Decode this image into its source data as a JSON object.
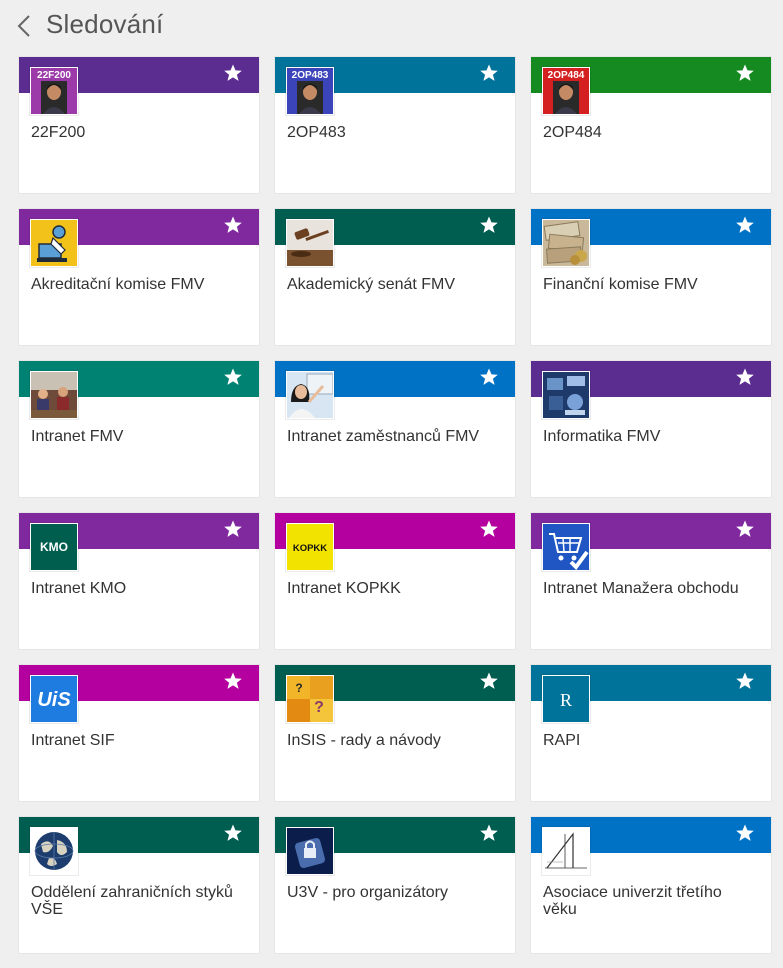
{
  "header": {
    "title": "Sledování",
    "back_icon": "chevron-left-icon"
  },
  "tiles": [
    {
      "name": "22F200",
      "color": "#5c2d91",
      "logo": "portrait-badge",
      "logo_text": "22F200",
      "logo_bg": "#9b3aa8"
    },
    {
      "name": "2OP483",
      "color": "#00739a",
      "logo": "portrait-badge",
      "logo_text": "2OP483",
      "logo_bg": "#3b44b8"
    },
    {
      "name": "2OP484",
      "color": "#148a21",
      "logo": "portrait-badge",
      "logo_text": "2OP484",
      "logo_bg": "#d42020"
    },
    {
      "name": "Akreditační komise FMV",
      "color": "#80299e",
      "logo": "person-computer",
      "logo_text": "",
      "logo_bg": "#f2c21a"
    },
    {
      "name": "Akademický senát FMV",
      "color": "#005e51",
      "logo": "gavel",
      "logo_text": "",
      "logo_bg": "#e8e3dc"
    },
    {
      "name": "Finanční komise FMV",
      "color": "#0072c6",
      "logo": "banknotes",
      "logo_text": "",
      "logo_bg": "#c9b99a"
    },
    {
      "name": "Intranet FMV",
      "color": "#008272",
      "logo": "classroom",
      "logo_text": "",
      "logo_bg": "#6e4a3a"
    },
    {
      "name": "Intranet zaměstnanců FMV",
      "color": "#0072c6",
      "logo": "presenter",
      "logo_text": "",
      "logo_bg": "#d7e6f2"
    },
    {
      "name": "Informatika FMV",
      "color": "#5c2d91",
      "logo": "tech-collage",
      "logo_text": "",
      "logo_bg": "#1d3a6b"
    },
    {
      "name": "Intranet KMO",
      "color": "#80299e",
      "logo": "text-badge",
      "logo_text": "KMO",
      "logo_bg": "#005e4e"
    },
    {
      "name": "Intranet KOPKK",
      "color": "#b4009e",
      "logo": "text-badge",
      "logo_text": "KOPKK",
      "logo_bg": "#f3e300"
    },
    {
      "name": "Intranet Manažera obchodu",
      "color": "#80299e",
      "logo": "cart",
      "logo_text": "",
      "logo_bg": "#1f56c4"
    },
    {
      "name": "Intranet SIF",
      "color": "#b4009e",
      "logo": "uis",
      "logo_text": "UiS",
      "logo_bg": "#1e7be0"
    },
    {
      "name": "InSIS - rady a návody",
      "color": "#005e51",
      "logo": "puzzle",
      "logo_text": "",
      "logo_bg": "#e2a21c"
    },
    {
      "name": "RAPI",
      "color": "#00739a",
      "logo": "letter",
      "logo_text": "R",
      "logo_bg": "#00739a"
    },
    {
      "name": "Oddělení zahraničních styků VŠE",
      "color": "#005e51",
      "logo": "globe",
      "logo_text": "",
      "logo_bg": "#ffffff"
    },
    {
      "name": "U3V - pro organizátory",
      "color": "#005e51",
      "logo": "lock",
      "logo_text": "",
      "logo_bg": "#0b1d4a"
    },
    {
      "name": "Asociace univerzit třetího věku",
      "color": "#0072c6",
      "logo": "triangle-logo",
      "logo_text": "",
      "logo_bg": "#ffffff"
    }
  ],
  "icons": {
    "star": "star-icon",
    "back": "chevron-left-icon"
  }
}
